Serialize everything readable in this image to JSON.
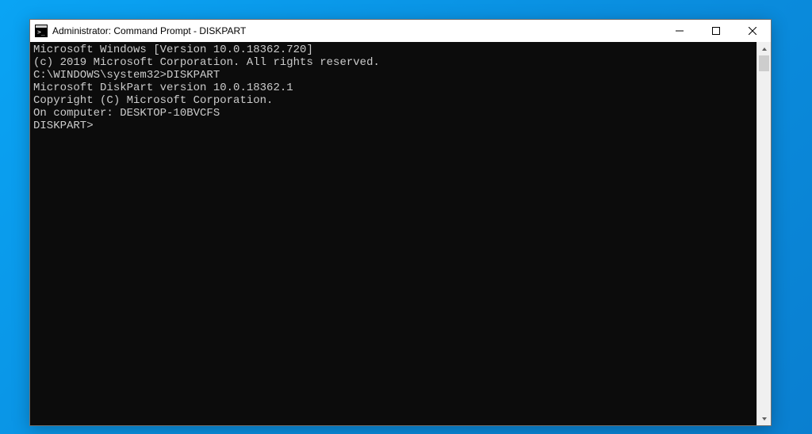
{
  "window": {
    "title": "Administrator: Command Prompt - DISKPART"
  },
  "terminal": {
    "lines": [
      "Microsoft Windows [Version 10.0.18362.720]",
      "(c) 2019 Microsoft Corporation. All rights reserved.",
      "",
      "C:\\WINDOWS\\system32>DISKPART",
      "",
      "Microsoft DiskPart version 10.0.18362.1",
      "",
      "Copyright (C) Microsoft Corporation.",
      "On computer: DESKTOP-10BVCFS",
      "",
      "DISKPART>"
    ]
  }
}
